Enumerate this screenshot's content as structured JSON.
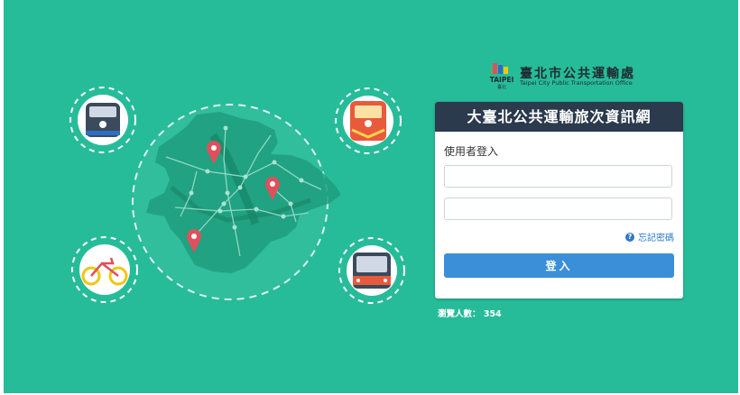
{
  "colors": {
    "background": "#27bc99",
    "header": "#2b3a4c",
    "button": "#3b8fd8",
    "pin": "#e0505a"
  },
  "brand": {
    "logo_label": "TAIPEI",
    "logo_sub": "臺北",
    "name_zh": "臺北市公共運輸處",
    "name_en": "Taipei City Public Transportation Office"
  },
  "hero": {
    "icons": [
      "metro-train-icon",
      "railway-train-icon",
      "ubike-bicycle-icon",
      "city-bus-icon",
      "map-pin-icon"
    ]
  },
  "login": {
    "title": "大臺北公共運輸旅次資訊網",
    "section_label": "使用者登入",
    "username_value": "",
    "password_value": "",
    "forgot_label": "忘記密碼",
    "submit_label": "登入"
  },
  "visitor": {
    "label": "瀏覽人數：",
    "count": "354"
  }
}
